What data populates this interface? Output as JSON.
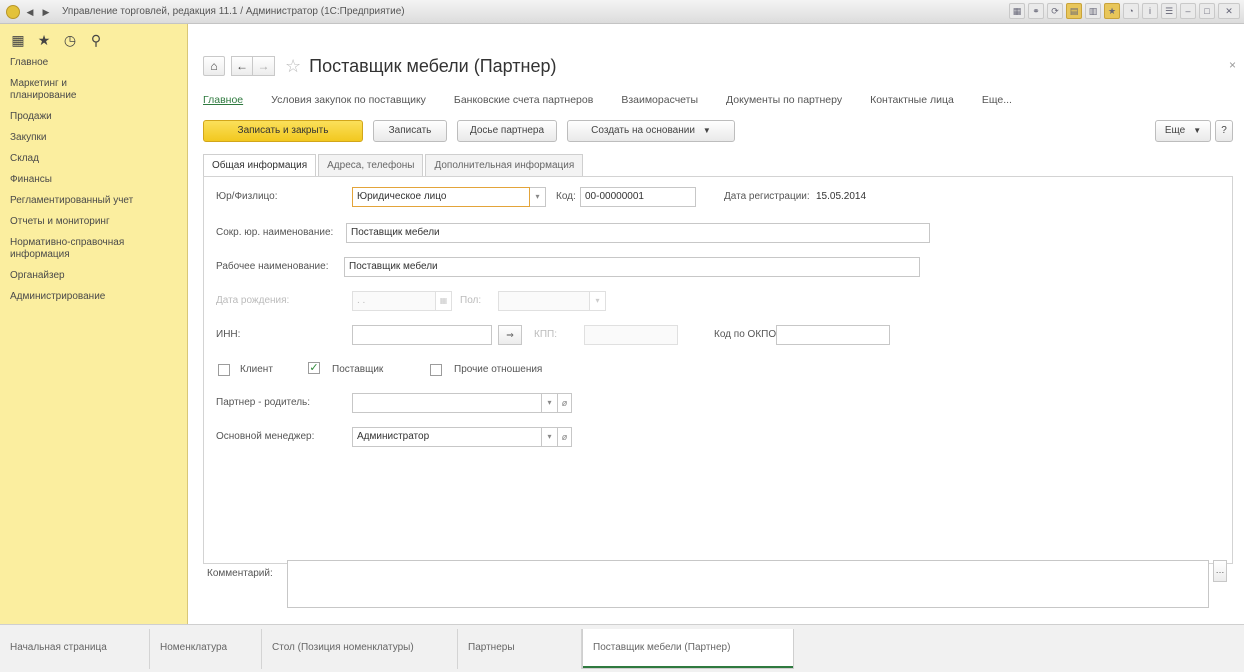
{
  "window": {
    "title": "Управление торговлей, редакция 11.1 / Администратор (1С:Предприятие)"
  },
  "sidebar": {
    "items": [
      "Главное",
      "Маркетинг и планирование",
      "Продажи",
      "Закупки",
      "Склад",
      "Финансы",
      "Регламентированный учет",
      "Отчеты и мониторинг",
      "Нормативно-справочная информация",
      "Органайзер",
      "Администрирование"
    ]
  },
  "header": {
    "title": "Поставщик мебели (Партнер)",
    "close": "×"
  },
  "sections": {
    "items": [
      "Главное",
      "Условия закупок по поставщику",
      "Банковские счета партнеров",
      "Взаиморасчеты",
      "Документы по партнеру",
      "Контактные лица"
    ],
    "more": "Еще..."
  },
  "toolbar": {
    "save_close": "Записать и закрыть",
    "save": "Записать",
    "dossier": "Досье партнера",
    "create_based": "Создать на основании",
    "more": "Еще",
    "help": "?"
  },
  "tabs": [
    "Общая информация",
    "Адреса, телефоны",
    "Дополнительная информация"
  ],
  "form": {
    "legal_label": "Юр/Физлицо:",
    "legal_value": "Юридическое лицо",
    "code_label": "Код:",
    "code_value": "00-00000001",
    "reg_date_label": "Дата регистрации:",
    "reg_date_value": "15.05.2014",
    "short_name_label": "Сокр. юр. наименование:",
    "short_name_value": "Поставщик мебели",
    "work_name_label": "Рабочее наименование:",
    "work_name_value": "Поставщик мебели",
    "birth_label": "Дата рождения:",
    "birth_value": " .  .",
    "sex_label": "Пол:",
    "inn_label": "ИНН:",
    "kpp_label": "КПП:",
    "okpo_label": "Код по ОКПО:",
    "client_label": "Клиент",
    "supplier_label": "Поставщик",
    "supplier_checked": true,
    "other_label": "Прочие отношения",
    "parent_label": "Партнер - родитель:",
    "manager_label": "Основной менеджер:",
    "manager_value": "Администратор",
    "comment_label": "Комментарий:"
  },
  "bottom_tabs": [
    "Начальная страница",
    "Номенклатура",
    "Стол (Позиция номенклатуры)",
    "Партнеры",
    "Поставщик мебели (Партнер)"
  ]
}
